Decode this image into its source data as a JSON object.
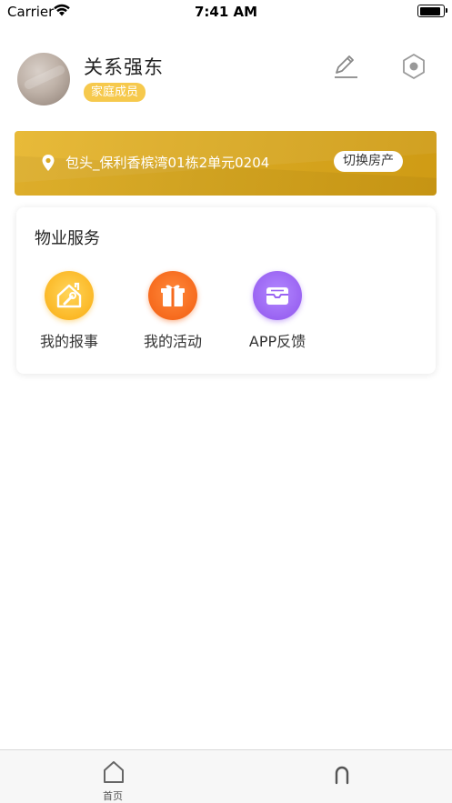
{
  "status_bar": {
    "carrier": "Carrier",
    "time": "7:41 AM",
    "battery_level": 0.95
  },
  "profile": {
    "name": "关系强东",
    "role_badge": "家庭成员"
  },
  "house": {
    "address": "包头_保利香槟湾01栋2单元0204",
    "switch_label": "切换房产"
  },
  "services": {
    "title": "物业服务",
    "items": [
      {
        "label": "我的报事",
        "icon": "house-wrench-icon"
      },
      {
        "label": "我的活动",
        "icon": "gift-icon"
      },
      {
        "label": "APP反馈",
        "icon": "inbox-icon"
      }
    ]
  },
  "tab_bar": {
    "tabs": [
      {
        "label": "首页",
        "icon": "home-icon"
      },
      {
        "label": "",
        "icon": "person-icon"
      }
    ]
  },
  "colors": {
    "banner": "#d9a923",
    "badge": "#f6c94d",
    "repair": "#fbb826",
    "activity": "#f66a1d",
    "feedback": "#9a64f2"
  }
}
